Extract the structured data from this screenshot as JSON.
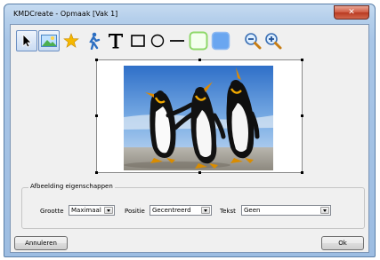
{
  "window": {
    "title": "KMDCreate - Opmaak [Vak 1]"
  },
  "toolbar": {
    "tools": [
      {
        "name": "pointer",
        "icon": "arrow-cursor-icon",
        "selected": true
      },
      {
        "name": "image",
        "icon": "landscape-image-icon",
        "selected": true
      },
      {
        "name": "star",
        "icon": "star-icon"
      },
      {
        "name": "clipart",
        "icon": "person-figure-icon"
      },
      {
        "name": "text",
        "icon": "text-t-icon"
      },
      {
        "name": "rectangle",
        "icon": "rectangle-icon"
      },
      {
        "name": "ellipse",
        "icon": "circle-icon"
      },
      {
        "name": "line",
        "icon": "line-icon"
      },
      {
        "name": "fill-green",
        "icon": "rounded-rect-green-icon"
      },
      {
        "name": "fill-blue",
        "icon": "rounded-rect-blue-icon"
      },
      {
        "name": "zoom-out",
        "icon": "zoom-out-icon"
      },
      {
        "name": "zoom-in",
        "icon": "zoom-in-icon"
      }
    ]
  },
  "properties": {
    "group_title": "Afbeelding eigenschappen",
    "size_label": "Grootte",
    "size_value": "Maximaal",
    "position_label": "Positie",
    "position_value": "Gecentreerd",
    "text_label": "Tekst",
    "text_value": "Geen"
  },
  "buttons": {
    "cancel": "Annuleren",
    "ok": "Ok"
  },
  "colors": {
    "accent": "#3a7bd5",
    "star": "#f5b800",
    "fill_green": "#9ee07a",
    "fill_blue": "#6aa6f0"
  }
}
